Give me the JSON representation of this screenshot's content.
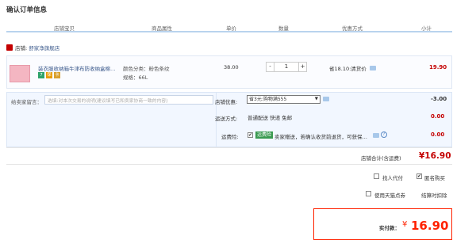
{
  "page_title": "确认订单信息",
  "table_headers": [
    "店铺宝贝",
    "商品属性",
    "单价",
    "数量",
    "优惠方式",
    "小计"
  ],
  "shop": {
    "label": "店铺:",
    "name": "舒家净旗舰店"
  },
  "item": {
    "title": "装衣服收纳箱牛津布防收纳盒棉…",
    "badges": [
      "7",
      "保",
      "卡"
    ],
    "attr_color": "颜色分类：粉色条纹",
    "attr_spec": "规格：66L",
    "price": "38.00",
    "qty_minus": "-",
    "qty": "1",
    "qty_plus": "+",
    "promo": "省18.10:清货价",
    "subtotal": "19.90"
  },
  "remark": {
    "label": "给卖家留言：",
    "placeholder": "选填:对本次交易的说明(建议填写已和卖家协商一致的内容)"
  },
  "coupon": {
    "label": "店铺优惠:",
    "selected": "省3元:购物满555",
    "amount": "-3.00"
  },
  "shipping": {
    "label": "运送方式:",
    "text": "普通配送 快递 免邮",
    "amount": "0.00"
  },
  "insurance": {
    "label": "运费险:",
    "checked": "✔",
    "tag": "运费险",
    "text": "卖家赠送，若确认收货前退货，可获保…",
    "amount": "0.00"
  },
  "store_total": {
    "label": "店铺合计(含运费)",
    "value": "¥16.90"
  },
  "options": {
    "pay_for_me": "找人代付",
    "anonymous": "匿名购买",
    "anonymous_checked": "✔",
    "tmall_points": "使用天猫点券",
    "settlement_deduction": "结算时扣除"
  },
  "pay": {
    "label": "实付款：",
    "currency": "¥",
    "value": "16.90"
  },
  "colors": {
    "accent_red": "#c40000",
    "pay_red": "#ff2200",
    "header_line": "#b9d3ee"
  }
}
